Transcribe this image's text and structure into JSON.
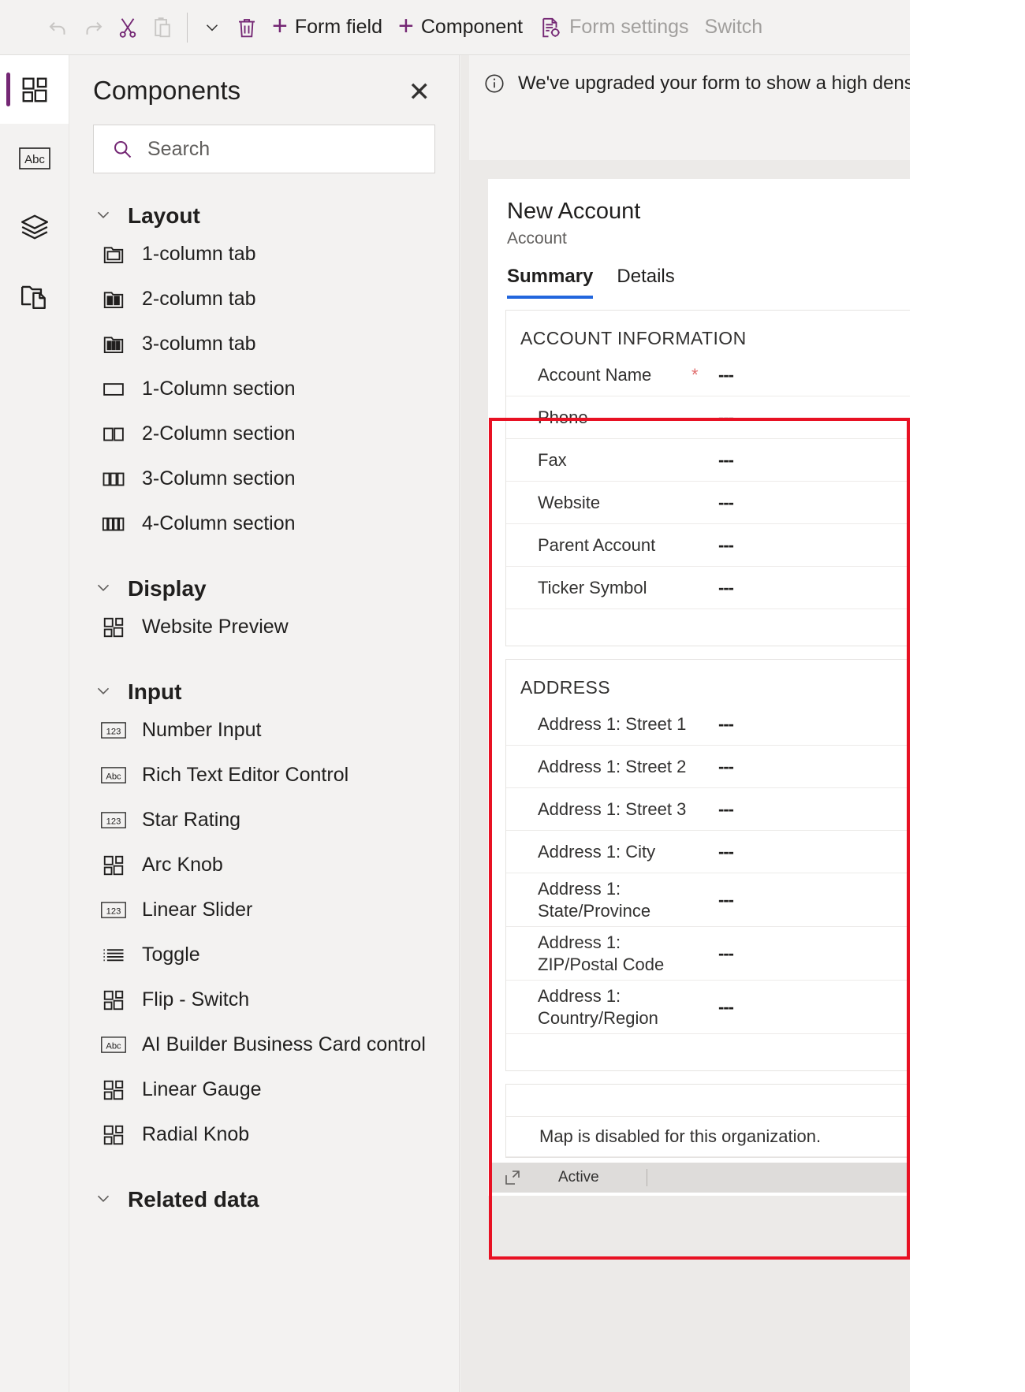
{
  "commandbar": {
    "items": [
      {
        "name": "undo",
        "icon": "undo-icon",
        "label": ""
      },
      {
        "name": "redo",
        "icon": "redo-icon",
        "label": ""
      },
      {
        "name": "cut",
        "icon": "scissors-icon",
        "label": ""
      },
      {
        "name": "paste",
        "icon": "clipboard-icon",
        "label": ""
      },
      {
        "name": "more",
        "icon": "chevron-down-icon",
        "label": ""
      },
      {
        "name": "delete",
        "icon": "trash-icon",
        "label": ""
      }
    ],
    "form_field_label": "Form field",
    "component_label": "Component",
    "form_settings_label": "Form settings",
    "switch_label": "Switch"
  },
  "rail": {
    "hamburger": "hamburger-icon",
    "items": [
      {
        "name": "components",
        "icon": "components-icon",
        "active": true
      },
      {
        "name": "fields",
        "icon": "abc-icon",
        "active": false
      },
      {
        "name": "layers",
        "icon": "layers-icon",
        "active": false
      },
      {
        "name": "templates",
        "icon": "folders-icon",
        "active": false
      }
    ]
  },
  "panel": {
    "title": "Components",
    "close_label": "✕",
    "search_placeholder": "Search",
    "groups": [
      {
        "label": "Layout",
        "expanded": true,
        "items": [
          {
            "label": "1-column tab",
            "icon": "tab-1col-icon"
          },
          {
            "label": "2-column tab",
            "icon": "tab-2col-icon"
          },
          {
            "label": "3-column tab",
            "icon": "tab-3col-icon"
          },
          {
            "label": "1-Column section",
            "icon": "section-1col-icon"
          },
          {
            "label": "2-Column section",
            "icon": "section-2col-icon"
          },
          {
            "label": "3-Column section",
            "icon": "section-3col-icon"
          },
          {
            "label": "4-Column section",
            "icon": "section-4col-icon"
          }
        ]
      },
      {
        "label": "Display",
        "expanded": true,
        "items": [
          {
            "label": "Website Preview",
            "icon": "component-icon"
          }
        ]
      },
      {
        "label": "Input",
        "expanded": true,
        "items": [
          {
            "label": "Number Input",
            "icon": "number-123-icon"
          },
          {
            "label": "Rich Text Editor Control",
            "icon": "abc-icon"
          },
          {
            "label": "Star Rating",
            "icon": "number-123-icon"
          },
          {
            "label": "Arc Knob",
            "icon": "component-icon"
          },
          {
            "label": "Linear Slider",
            "icon": "number-123-icon"
          },
          {
            "label": "Toggle",
            "icon": "list-icon"
          },
          {
            "label": "Flip - Switch",
            "icon": "component-icon"
          },
          {
            "label": "AI Builder Business Card control",
            "icon": "abc-icon"
          },
          {
            "label": "Linear Gauge",
            "icon": "component-icon"
          },
          {
            "label": "Radial Knob",
            "icon": "component-icon"
          }
        ]
      },
      {
        "label": "Related data",
        "expanded": true,
        "items": []
      }
    ]
  },
  "canvas": {
    "notification": {
      "icon": "info-icon",
      "text": "We've upgraded your form to show a high density hea"
    },
    "form": {
      "title": "New Account",
      "subtitle": "Account",
      "tabs": [
        {
          "label": "Summary",
          "active": true
        },
        {
          "label": "Details",
          "active": false
        }
      ],
      "sections": [
        {
          "title": "ACCOUNT INFORMATION",
          "rows": [
            {
              "label": "Account Name",
              "required": "*",
              "value": "---"
            },
            {
              "label": "Phone",
              "required": "",
              "value": "---"
            },
            {
              "label": "Fax",
              "required": "",
              "value": "---"
            },
            {
              "label": "Website",
              "required": "",
              "value": "---"
            },
            {
              "label": "Parent Account",
              "required": "",
              "value": "---"
            },
            {
              "label": "Ticker Symbol",
              "required": "",
              "value": "---"
            }
          ]
        },
        {
          "title": "ADDRESS",
          "rows": [
            {
              "label": "Address 1: Street 1",
              "required": "",
              "value": "---"
            },
            {
              "label": "Address 1: Street 2",
              "required": "",
              "value": "---"
            },
            {
              "label": "Address 1: Street 3",
              "required": "",
              "value": "---"
            },
            {
              "label": "Address 1: City",
              "required": "",
              "value": "---"
            },
            {
              "label": "Address 1: State/Province",
              "required": "",
              "value": "---"
            },
            {
              "label": "Address 1: ZIP/Postal Code",
              "required": "",
              "value": "---"
            },
            {
              "label": "Address 1: Country/Region",
              "required": "",
              "value": "---"
            }
          ]
        }
      ],
      "map_message": "Map is disabled for this organization.",
      "status": {
        "icon": "popout-icon",
        "text": "Active"
      }
    }
  },
  "colors": {
    "accent_purple": "#742774",
    "tab_underline": "#2266dd",
    "highlight_red": "#e81123",
    "required_red": "#e06c6c",
    "panel_bg": "#f3f2f1",
    "canvas_bg": "#eceae8"
  }
}
